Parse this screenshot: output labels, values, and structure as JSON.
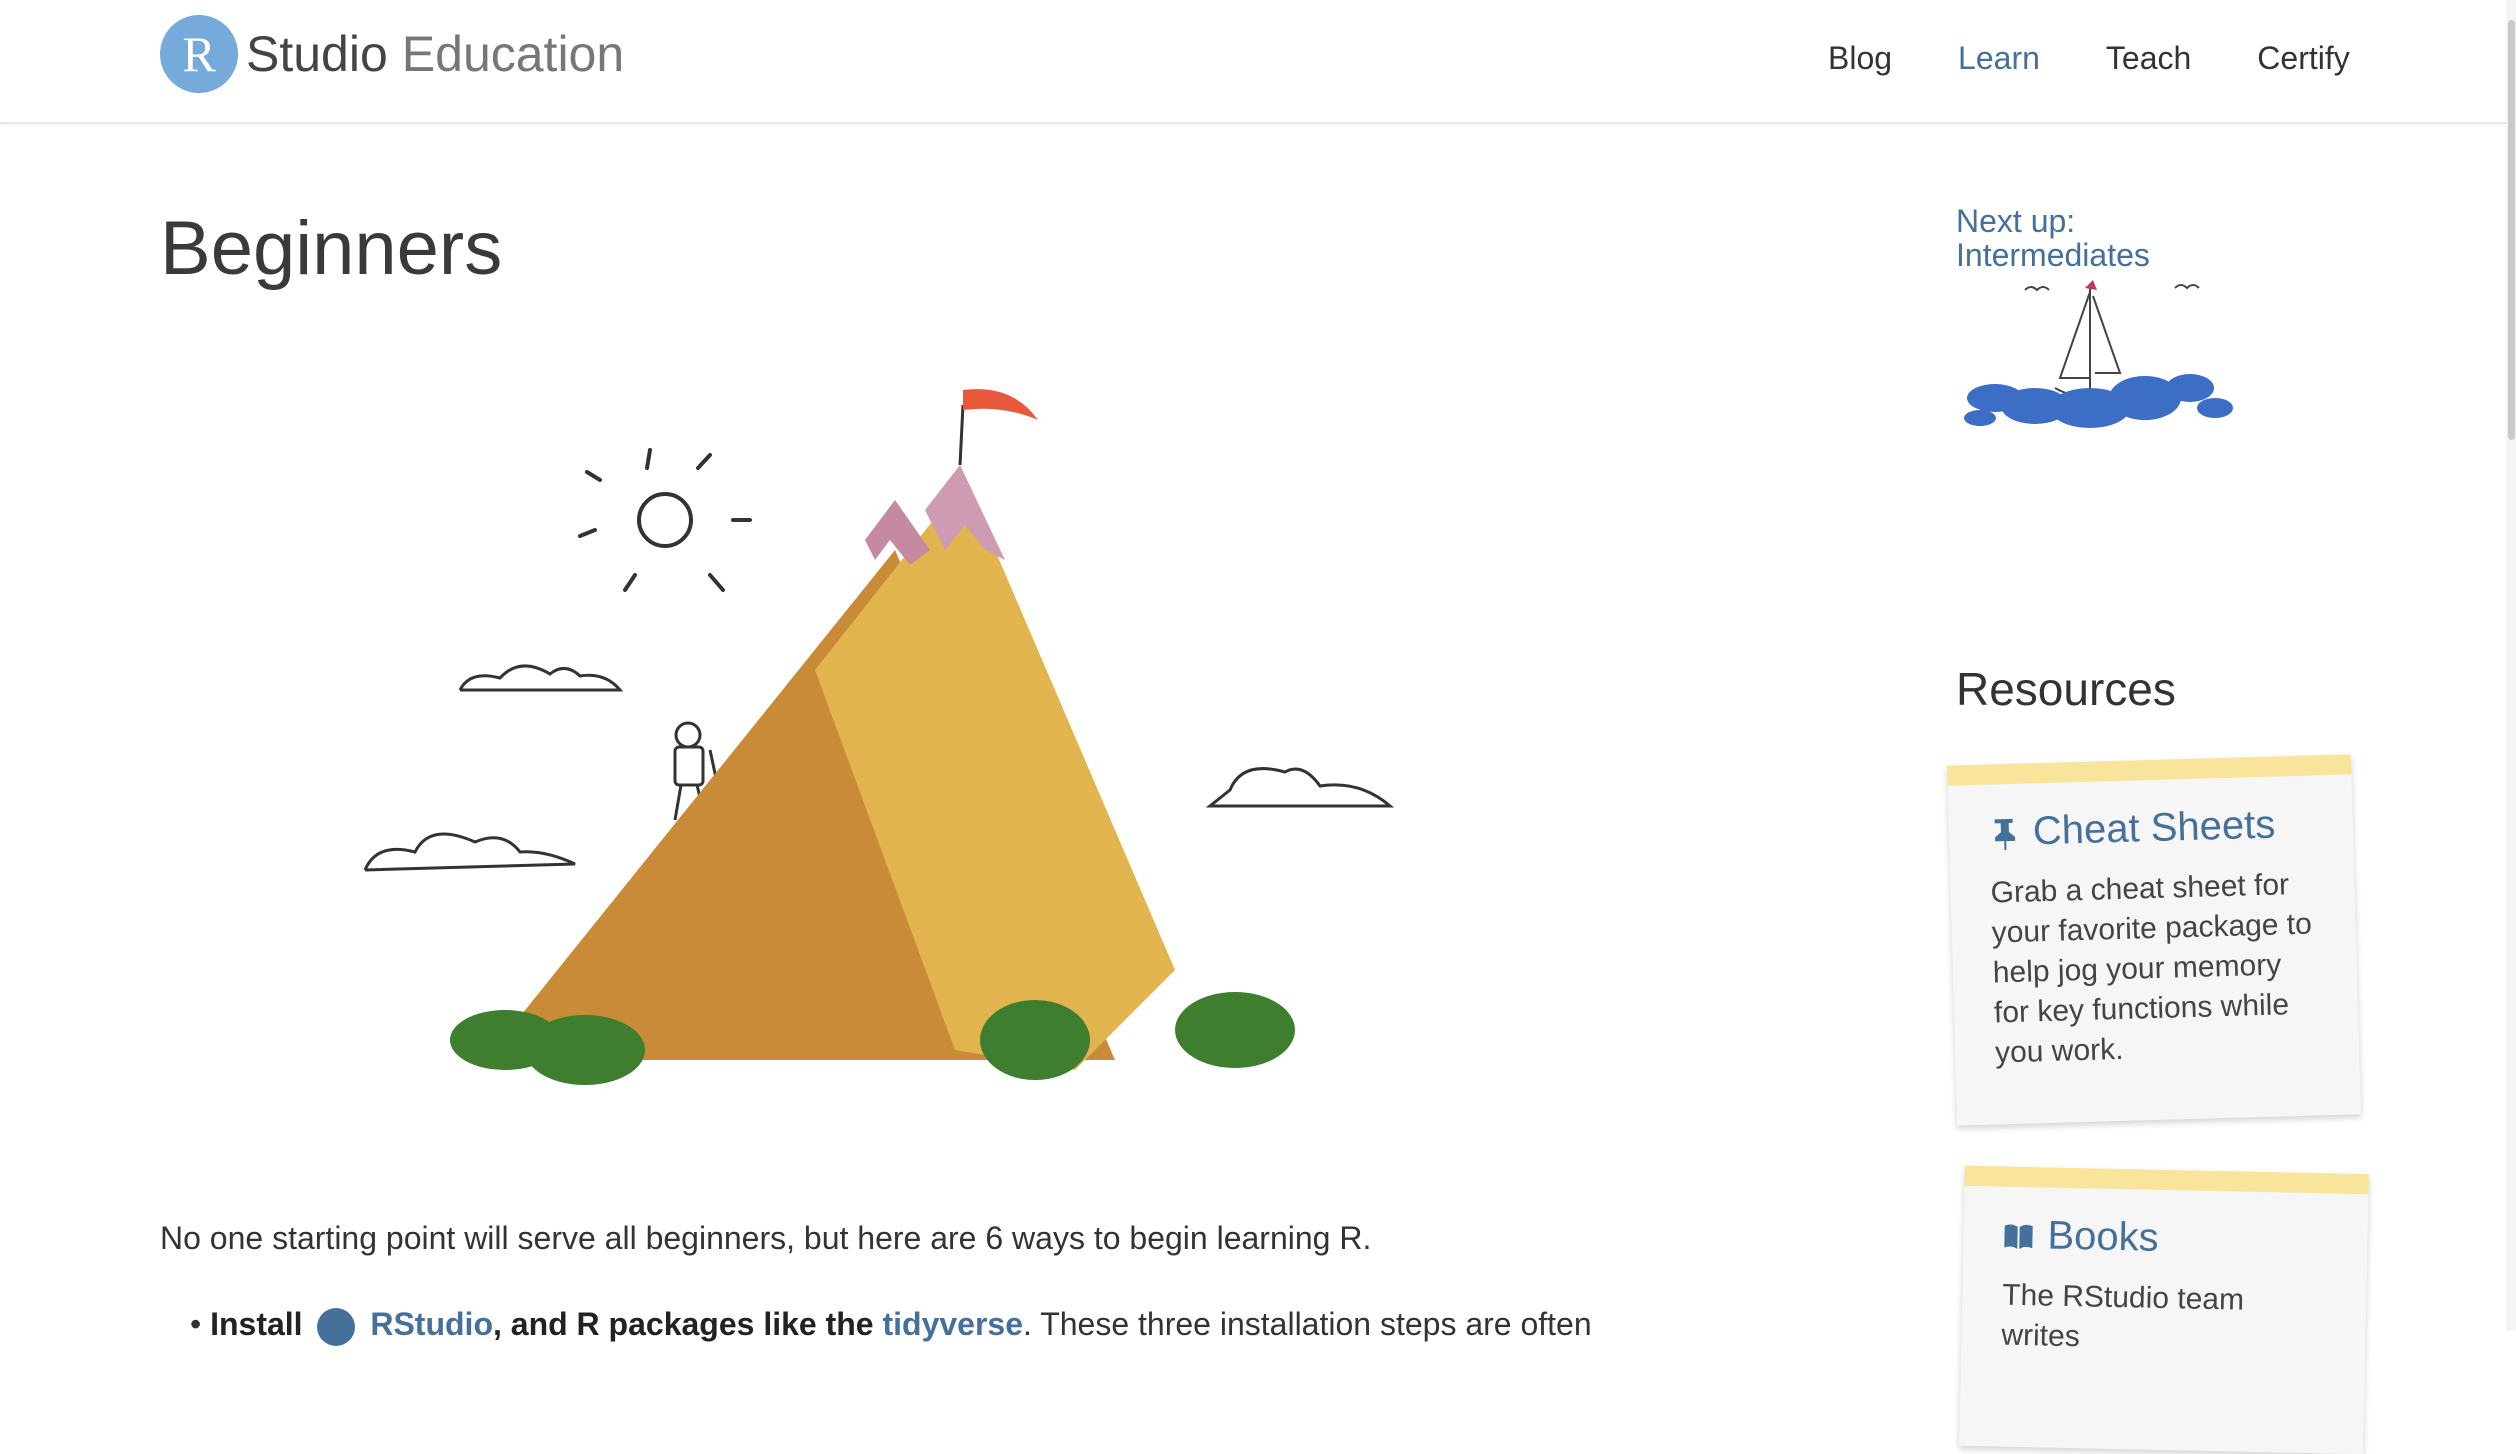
{
  "header": {
    "logo_letter": "R",
    "logo_studio": "Studio",
    "logo_education": "Education",
    "nav": [
      "Blog",
      "Learn",
      "Teach",
      "Certify"
    ],
    "nav_active": "Learn"
  },
  "main": {
    "title": "Beginners",
    "intro": "No one starting point will serve all beginners, but here are 6 ways to begin learning R.",
    "bullet": {
      "install_label": "Install",
      "rstudio_link": "RStudio",
      "mid_text": ", and R packages like the",
      "tidyverse_link": "tidyverse",
      "rest_text": ". These three installation steps are often"
    }
  },
  "sidebar": {
    "next_up_line1": "Next up:",
    "next_up_line2": "Intermediates",
    "resources_title": "Resources",
    "cards": [
      {
        "title": "Cheat Sheets",
        "text": "Grab a cheat sheet for your favorite package to help jog your memory for key functions while you work.",
        "icon": "pin-icon"
      },
      {
        "title": "Books",
        "text": "The RStudio team writes",
        "icon": "book-icon"
      }
    ]
  },
  "colors": {
    "brand_blue": "#75AADB",
    "link_blue": "#447099",
    "card_tape": "#f8e49a"
  }
}
